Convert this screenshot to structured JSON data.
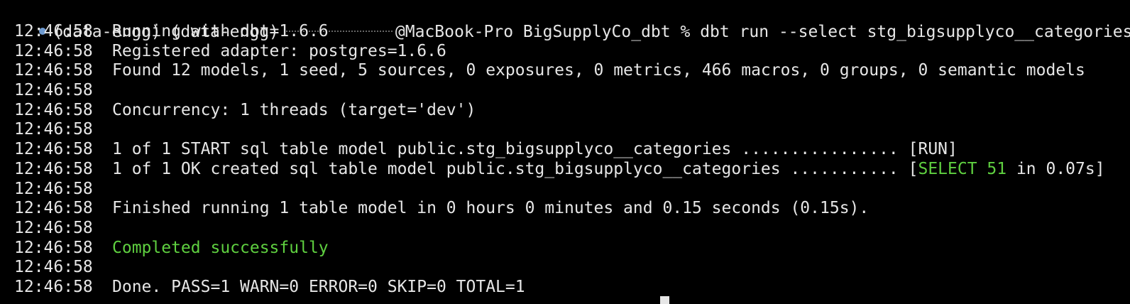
{
  "colors": {
    "background": "#000000",
    "text": "#e6e6e6",
    "success": "#5fd040",
    "prompt_dot": "#6e9ad0"
  },
  "prompt": {
    "env1": "(data-engg)",
    "env2": "(data-engg)",
    "host_dir": "@MacBook-Pro BigSupplyCo_dbt %",
    "command": "dbt run --select stg_bigsupplyco__categories"
  },
  "log": {
    "timestamp": "12:46:58",
    "running": "Running with dbt=1.6.6",
    "adapter": "Registered adapter: postgres=1.6.6",
    "found": "Found 12 models, 1 seed, 5 sources, 0 exposures, 0 metrics, 466 macros, 0 groups, 0 semantic models",
    "concurrency": "Concurrency: 1 threads (target='dev')",
    "start": "1 of 1 START sql table model public.stg_bigsupplyco__categories ................ [RUN]",
    "ok_prefix": "1 of 1 OK created sql table model public.stg_bigsupplyco__categories ........... [",
    "ok_select": "SELECT 51",
    "ok_suffix": " in 0.07s]",
    "finished": "Finished running 1 table model in 0 hours 0 minutes and 0.15 seconds (0.15s).",
    "completed": "Completed successfully",
    "done": "Done. PASS=1 WARN=0 ERROR=0 SKIP=0 TOTAL=1"
  }
}
